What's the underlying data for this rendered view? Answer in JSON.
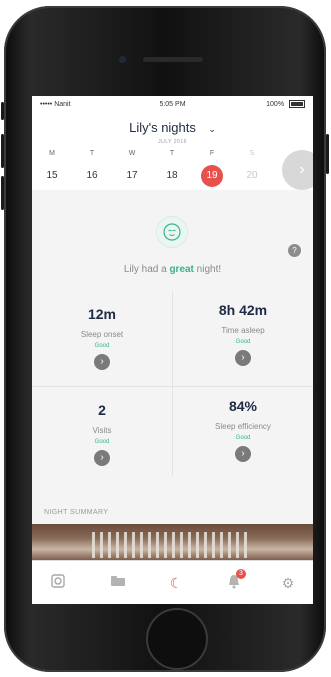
{
  "status": {
    "carrier": "••••• Nanit",
    "time": "5:05 PM",
    "battery": "100%"
  },
  "header": {
    "title": "Lily's nights",
    "subtitle": "JULY 2016",
    "chevron_icon": "chevron-down-icon"
  },
  "week": {
    "days": [
      {
        "letter": "M",
        "num": "15"
      },
      {
        "letter": "T",
        "num": "16"
      },
      {
        "letter": "W",
        "num": "17"
      },
      {
        "letter": "T",
        "num": "18"
      },
      {
        "letter": "F",
        "num": "19",
        "selected": true
      },
      {
        "letter": "S",
        "num": "20",
        "muted": true
      }
    ],
    "next_icon": "chevron-right-icon"
  },
  "summary": {
    "prefix": "Lily had a ",
    "highlight": "great",
    "suffix": " night!"
  },
  "metrics": [
    {
      "value": "12m",
      "label": "Sleep onset",
      "status": "Good"
    },
    {
      "value": "8h 42m",
      "label": "Time asleep",
      "status": "Good"
    },
    {
      "value": "2",
      "label": "Visits",
      "status": "Good"
    },
    {
      "value": "84%",
      "label": "Sleep efficiency",
      "status": "Good"
    }
  ],
  "night_summary_label": "NIGHT SUMMARY",
  "tabbar": {
    "items": [
      "camera-icon",
      "bed-icon",
      "moon-icon",
      "bell-icon",
      "gear-icon"
    ],
    "notification_badge": "3"
  },
  "colors": {
    "accent": "#e8504e",
    "good": "#3bb38a",
    "text_dark": "#1f2a44"
  }
}
